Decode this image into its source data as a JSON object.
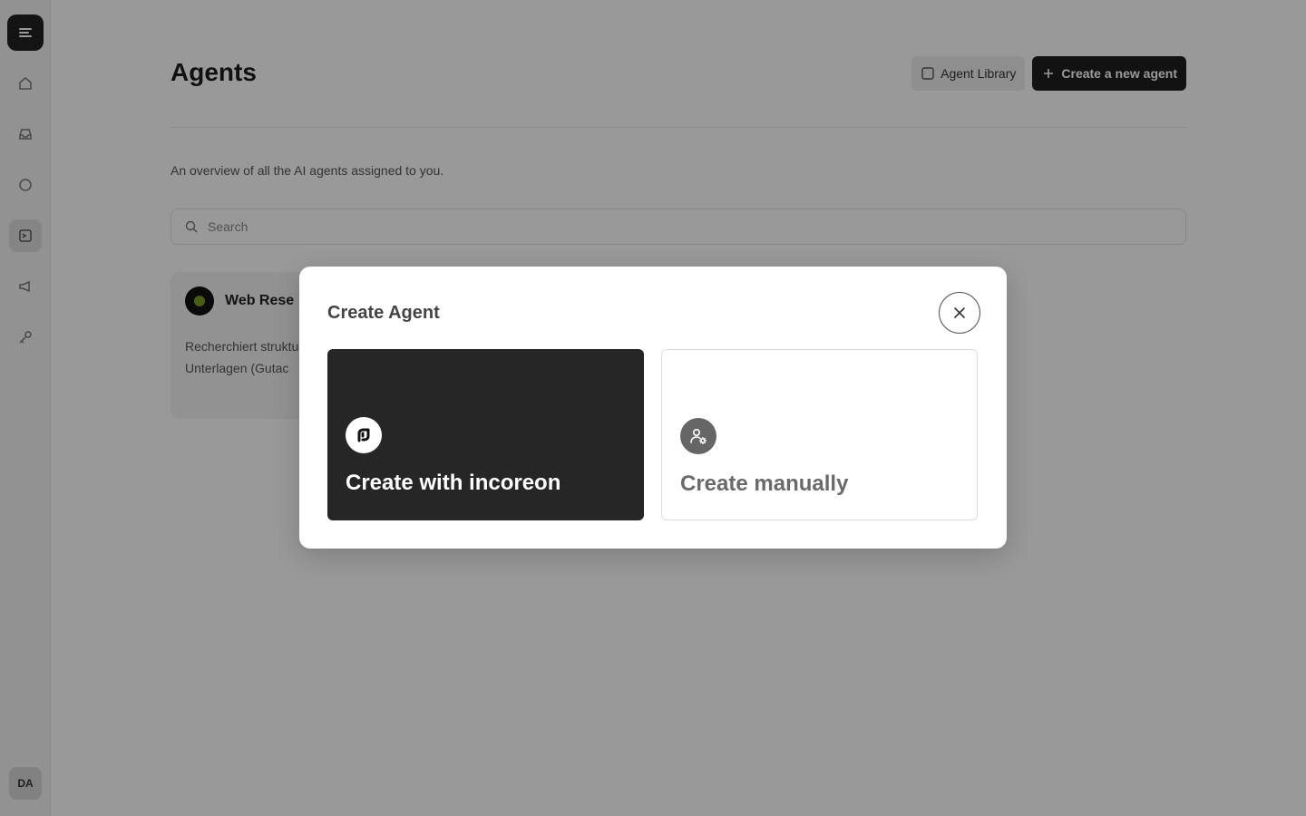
{
  "page": {
    "title": "Agents",
    "subtitle": "An overview of all the AI agents assigned to you.",
    "actions": {
      "library_label": "Agent Library",
      "create_label": "Create a new agent"
    },
    "search": {
      "placeholder": "Search"
    }
  },
  "sidebar": {
    "items": [
      {
        "icon": "home-icon"
      },
      {
        "icon": "inbox-icon"
      },
      {
        "icon": "chat-icon"
      },
      {
        "icon": "agents-icon",
        "active": true
      },
      {
        "icon": "megaphone-icon"
      },
      {
        "icon": "key-icon"
      }
    ],
    "user_initials": "DA"
  },
  "agent_cards": [
    {
      "name": "Web Rese",
      "description_lines": [
        "Recherchiert struktu",
        "Unterlagen (Gutac"
      ]
    }
  ],
  "modal": {
    "title": "Create Agent",
    "options": [
      {
        "label": "Create with incoreon",
        "icon": "incoreon-logo-icon"
      },
      {
        "label": "Create manually",
        "icon": "user-settings-icon"
      }
    ]
  },
  "colors": {
    "overlay": "rgba(0,0,0,0.4)",
    "ai_card_bg": "#262626",
    "manual_icon_bg": "#666666",
    "primary_button": "#1f1f1f"
  }
}
